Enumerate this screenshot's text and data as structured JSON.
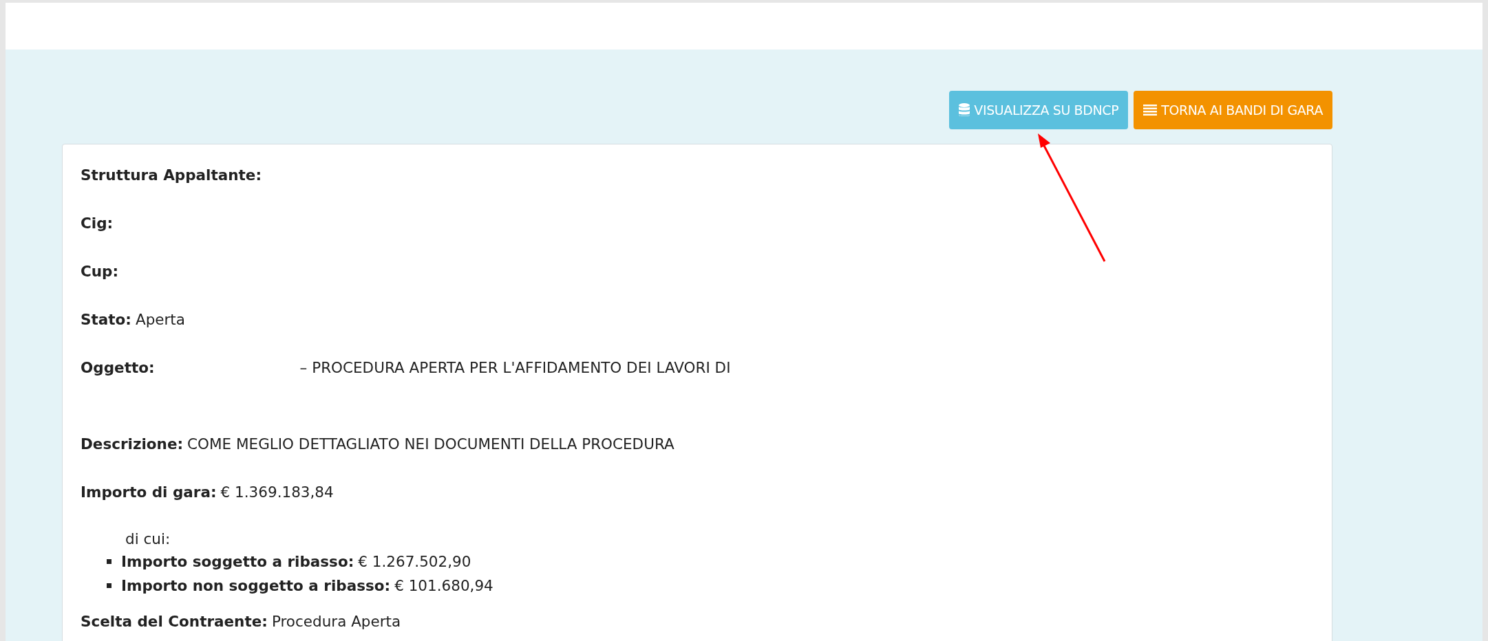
{
  "actions": [
    {
      "kind": "database",
      "label": "VISUALIZZA SU BDNCP"
    },
    {
      "kind": "list",
      "label": "TORNA AI BANDI DI GARA"
    }
  ],
  "details": [
    {
      "kind": "field",
      "label": "Struttura Appaltante:"
    },
    {
      "kind": "field",
      "label": "Cig:"
    },
    {
      "kind": "field",
      "label": "Cup:"
    },
    {
      "kind": "field",
      "label": "Stato:",
      "value": "Aperta"
    },
    {
      "kind": "spaced_field",
      "label": "Oggetto:",
      "value": "– PROCEDURA APERTA PER L'AFFIDAMENTO DEI LAVORI DI"
    },
    {
      "kind": "field",
      "label": "Descrizione:",
      "value": "COME MEGLIO DETTAGLIATO NEI DOCUMENTI DELLA PROCEDURA"
    },
    {
      "kind": "field",
      "label": "Importo di gara:",
      "value": "€ 1.369.183,84"
    },
    {
      "kind": "breakdown",
      "intro": "di cui:",
      "items": [
        {
          "label": "Importo soggetto a ribasso:",
          "value": "€ 1.267.502,90"
        },
        {
          "label": "Importo non soggetto a ribasso:",
          "value": "€ 101.680,94"
        }
      ]
    },
    {
      "kind": "field",
      "label": "Scelta del Contraente:",
      "value": "Procedura Aperta"
    }
  ]
}
